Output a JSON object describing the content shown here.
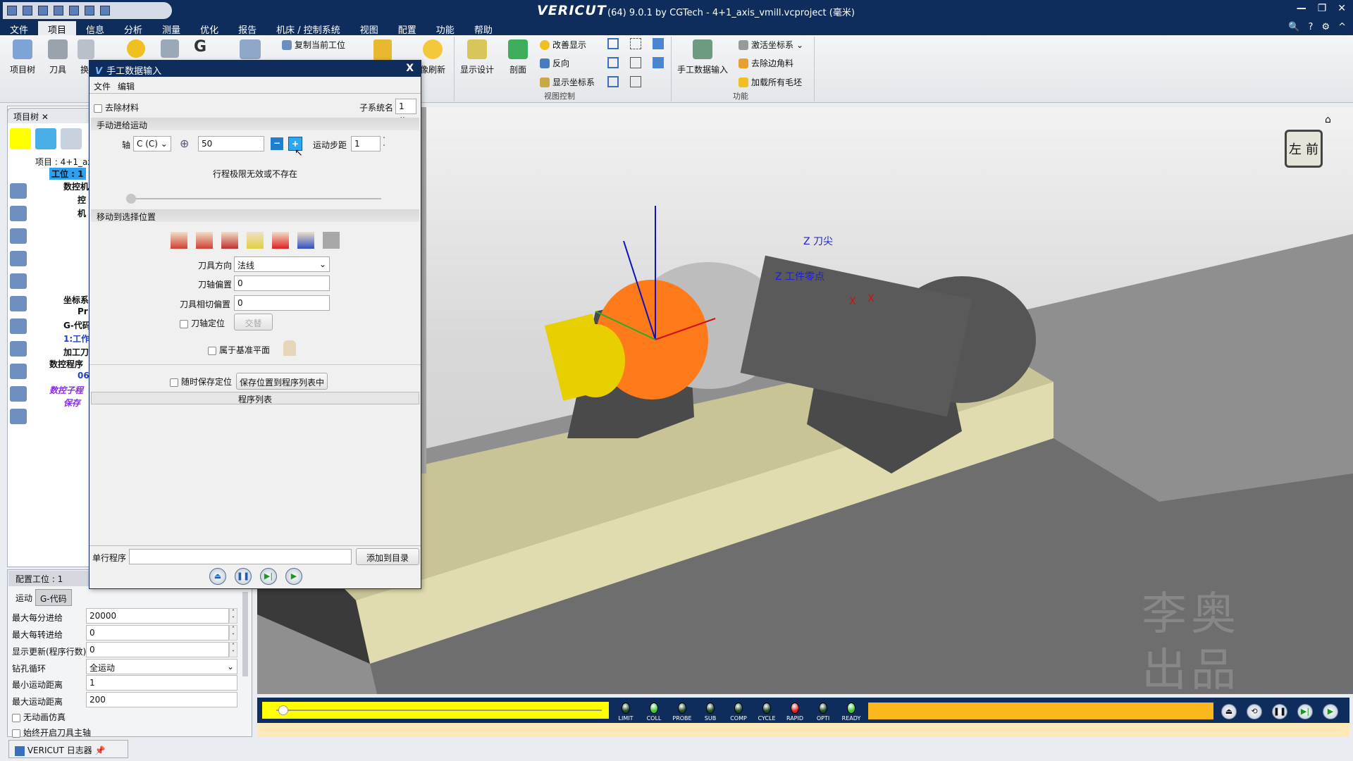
{
  "titlebar": {
    "brand": "VERICUT",
    "title": "(64) 9.0.1 by CGTech - 4+1_axis_vmill.vcproject (毫米)",
    "controls": [
      "—",
      "❐",
      "✕"
    ]
  },
  "menu": {
    "items": [
      "文件",
      "项目",
      "信息",
      "分析",
      "测量",
      "优化",
      "报告",
      "机床 / 控制系统",
      "视图",
      "配置",
      "功能",
      "帮助"
    ],
    "active": "项目"
  },
  "help_icons": [
    "🔍",
    "?",
    "⚙",
    "^"
  ],
  "ribbon": {
    "large": [
      "项目树",
      "刀具",
      "换",
      "显示设计",
      "剖面",
      "像刷新",
      "手工数据输入"
    ],
    "copy_setup": "复制当前工位",
    "view_small": [
      "改善显示",
      "反向",
      "显示坐标系"
    ],
    "func_small": [
      "激活坐标系",
      "去除边角料",
      "加载所有毛坯"
    ],
    "groups": [
      "视图控制",
      "功能"
    ]
  },
  "project_tree": {
    "tab": "项目树",
    "nodes": [
      "项目 : 4+1_ax",
      "工位 : 1",
      "数控机",
      "控",
      "机",
      "坐标系",
      "Pr",
      "G-代码",
      "1:工作",
      "加工刀",
      "数控程序",
      "06",
      "数控子程",
      "保存"
    ]
  },
  "config": {
    "header": "配置工位 : 1",
    "tabs": [
      "运动",
      "G-代码"
    ],
    "fields": [
      {
        "label": "最大每分进给",
        "value": "20000"
      },
      {
        "label": "最大每转进给",
        "value": "0"
      },
      {
        "label": "显示更新(程序行数)",
        "value": "0"
      },
      {
        "label": "钻孔循环",
        "value": "全运动"
      },
      {
        "label": "最小运动距离",
        "value": "1"
      },
      {
        "label": "最大运动距离",
        "value": "200"
      }
    ],
    "checks": [
      "无动画仿真",
      "始终开启刀具主轴"
    ]
  },
  "log_tab": "VERICUT 日志器",
  "dialog": {
    "title": "手工数据输入",
    "close": "X",
    "menu": [
      "文件",
      "编辑"
    ],
    "remove_material": "去除材料",
    "subsystem_label": "子系统名",
    "subsystem_value": "1",
    "jog_section": "手动进给运动",
    "axis_label": "轴",
    "axis_value": "C (C)",
    "position_value": "50",
    "step_label": "运动步距",
    "step_value": "1",
    "limit_msg": "行程极限无效或不存在",
    "move_section": "移动到选择位置",
    "tool_dir_label": "刀具方向",
    "tool_dir_value": "法线",
    "axis_offset_label": "刀轴偏置",
    "axis_offset_value": "0",
    "tangent_offset_label": "刀具相切偏置",
    "tangent_offset_value": "0",
    "axis_orient_label": "刀轴定位",
    "alternate_btn": "交替",
    "base_plane_label": "属于基准平面",
    "save_anytime_label": "随时保存定位",
    "save_to_list_btn": "保存位置到程序列表中",
    "program_list_header": "程序列表",
    "single_line_label": "单行程序",
    "single_line_value": "",
    "add_to_list_btn": "添加到目录",
    "playback": [
      "⏏",
      "❚❚",
      "▶|",
      "▶"
    ]
  },
  "viewport": {
    "labels": [
      "Z 刀尖",
      "Z 工件零点",
      "X",
      "X"
    ],
    "view_cube": [
      "左",
      "前"
    ],
    "watermark": "李奥 出品"
  },
  "status": {
    "leds": [
      {
        "name": "LIMIT",
        "color": "#1e4a2a"
      },
      {
        "name": "COLL",
        "color": "#3fc23f"
      },
      {
        "name": "PROBE",
        "color": "#1e4a2a"
      },
      {
        "name": "SUB",
        "color": "#1e4a2a"
      },
      {
        "name": "COMP",
        "color": "#1e4a2a"
      },
      {
        "name": "CYCLE",
        "color": "#1e4a2a"
      },
      {
        "name": "RAPID",
        "color": "#e02020"
      },
      {
        "name": "OPTI",
        "color": "#1e4a2a"
      },
      {
        "name": "READY",
        "color": "#3fc23f"
      }
    ],
    "slider_value": 0.02,
    "controls": [
      "⏏",
      "⟲",
      "❚❚",
      "▶|",
      "▶"
    ]
  }
}
